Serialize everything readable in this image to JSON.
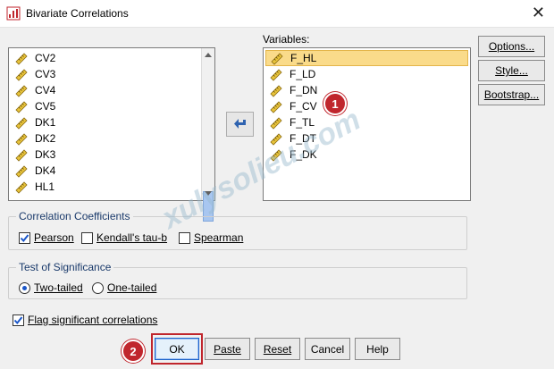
{
  "window": {
    "title": "Bivariate Correlations",
    "close_glyph": "✕"
  },
  "source_list": {
    "items": [
      "CV2",
      "CV3",
      "CV4",
      "CV5",
      "DK1",
      "DK2",
      "DK3",
      "DK4",
      "HL1"
    ]
  },
  "variables": {
    "label": "Variables:",
    "items": [
      "F_HL",
      "F_LD",
      "F_DN",
      "F_CV",
      "F_TL",
      "F_DT",
      "F_DK"
    ],
    "selected_index": 0
  },
  "side_buttons": {
    "options": "Options...",
    "style": "Style...",
    "bootstrap": "Bootstrap..."
  },
  "coefficients": {
    "legend": "Correlation Coefficients",
    "pearson": {
      "label": "Pearson",
      "checked": true
    },
    "kendall": {
      "label": "Kendall's tau-b",
      "checked": false
    },
    "spearman": {
      "label": "Spearman",
      "checked": false
    }
  },
  "significance": {
    "legend": "Test of Significance",
    "two_tailed": {
      "label": "Two-tailed",
      "selected": true
    },
    "one_tailed": {
      "label": "One-tailed",
      "selected": false
    }
  },
  "flag": {
    "label": "Flag significant correlations",
    "checked": true
  },
  "buttons": {
    "ok": "OK",
    "paste": "Paste",
    "reset": "Reset",
    "cancel": "Cancel",
    "help": "Help"
  },
  "annotations": {
    "badge1": "1",
    "badge2": "2"
  },
  "watermark": "xulysolieu.com",
  "colors": {
    "selection": "#fadb8a",
    "badge": "#c0262d",
    "group_legend": "#1a3a6b"
  }
}
